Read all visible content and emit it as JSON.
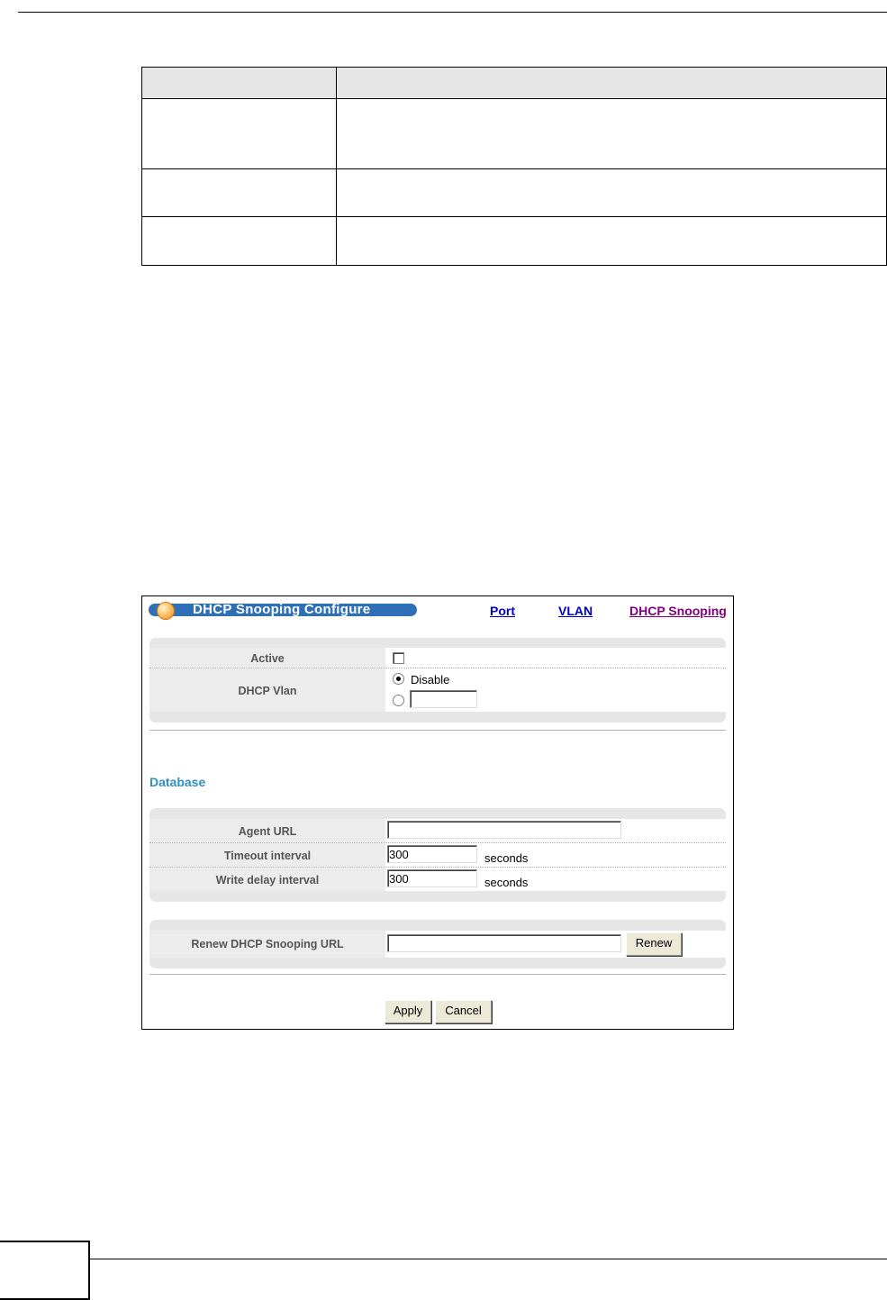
{
  "figure": {
    "title": "DHCP Snooping Configure",
    "nav_links": [
      "Port",
      "VLAN",
      "DHCP Snooping"
    ],
    "settings": {
      "active_label": "Active",
      "active_checked": false,
      "dhcp_vlan_label": "DHCP Vlan",
      "dhcp_vlan_option_disable": "Disable",
      "dhcp_vlan_selected": "Disable",
      "dhcp_vlan_value": ""
    },
    "database": {
      "heading": "Database",
      "agent_url_label": "Agent URL",
      "agent_url_value": "",
      "timeout_label": "Timeout interval",
      "timeout_value": "300",
      "timeout_unit": "seconds",
      "write_delay_label": "Write delay interval",
      "write_delay_value": "300",
      "write_delay_unit": "seconds"
    },
    "renew": {
      "label": "Renew DHCP Snooping URL",
      "value": "",
      "button": "Renew"
    },
    "buttons": {
      "apply": "Apply",
      "cancel": "Cancel"
    }
  }
}
